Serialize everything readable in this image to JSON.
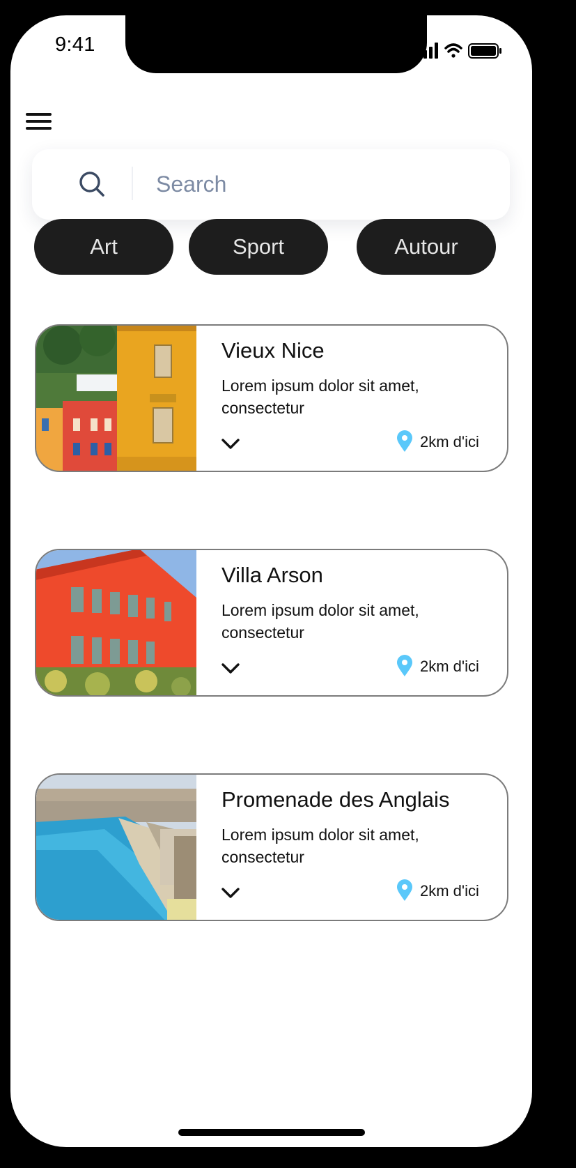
{
  "status_bar": {
    "time": "9:41",
    "icons": [
      "signal-icon",
      "wifi-icon",
      "battery-icon"
    ]
  },
  "menu": {
    "icon": "hamburger-menu-icon"
  },
  "search": {
    "placeholder": "Search",
    "value": "",
    "icon": "search-icon"
  },
  "filters": [
    {
      "label": "Art"
    },
    {
      "label": "Sport"
    },
    {
      "label": "Autour"
    }
  ],
  "places": [
    {
      "title": "Vieux Nice",
      "description": "Lorem ipsum dolor sit amet, consectetur",
      "distance": "2km d'ici",
      "image": "old-town-facades-photo"
    },
    {
      "title": "Villa Arson",
      "description": "Lorem ipsum dolor sit amet, consectetur",
      "distance": "2km d'ici",
      "image": "red-villa-photo"
    },
    {
      "title": "Promenade des Anglais",
      "description": "Lorem ipsum dolor sit amet, consectetur",
      "distance": "2km d'ici",
      "image": "seafront-bay-photo"
    }
  ],
  "colors": {
    "chip_background": "#1d1d1d",
    "chip_text": "#e6e6e6",
    "pin": "#5ac8fa",
    "card_border": "#7b7b7b",
    "placeholder": "#7c8aa3"
  }
}
